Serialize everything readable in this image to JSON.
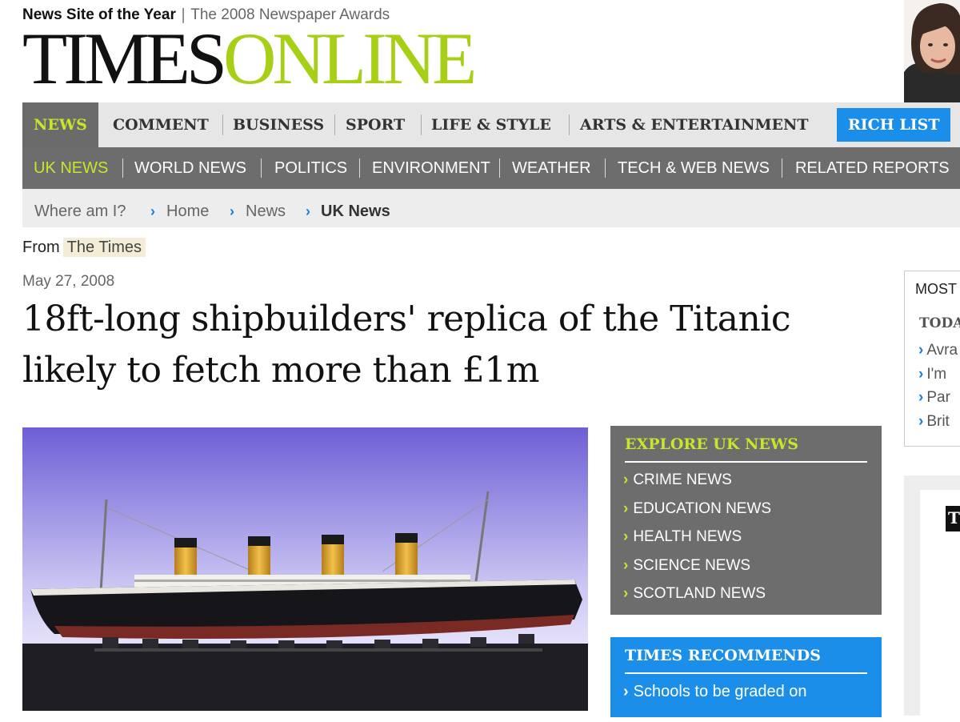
{
  "masthead": {
    "award_bold": "News Site of the Year",
    "award_rest": "The 2008 Newspaper Awards",
    "logo_times": "TIMES",
    "logo_online": "ONLINE"
  },
  "nav_primary": {
    "items": [
      "NEWS",
      "COMMENT",
      "BUSINESS",
      "SPORT",
      "LIFE & STYLE",
      "ARTS & ENTERTAINMENT"
    ],
    "active": "NEWS",
    "rich_list": "RICH LIST"
  },
  "nav_secondary": {
    "items": [
      "UK NEWS",
      "WORLD NEWS",
      "POLITICS",
      "ENVIRONMENT",
      "WEATHER",
      "TECH & WEB NEWS",
      "RELATED REPORTS"
    ],
    "active": "UK NEWS"
  },
  "breadcrumb": {
    "prefix": "Where am I?",
    "items": [
      "Home",
      "News",
      "UK News"
    ]
  },
  "article": {
    "from_label": "From",
    "publication": "The Times",
    "date": "May 27, 2008",
    "headline": "18ft-long shipbuilders' replica of the Titanic likely to fetch more than £1m"
  },
  "explore": {
    "title": "EXPLORE UK NEWS",
    "items": [
      "CRIME NEWS",
      "EDUCATION NEWS",
      "HEALTH NEWS",
      "SCIENCE NEWS",
      "SCOTLAND NEWS"
    ]
  },
  "recommends": {
    "title": "TIMES RECOMMENDS",
    "items": [
      "Schools to be graded on"
    ]
  },
  "most_panel": {
    "title": "MOST",
    "tab": "TODA",
    "items": [
      "Avra",
      "I'm",
      "Par",
      "Brit"
    ]
  },
  "side_box": {
    "letter": "T"
  },
  "colors": {
    "accent_green": "#c7e52a",
    "logo_green": "#a6cf16",
    "nav_gray": "#6d6d6d",
    "link_blue": "#1a8ee8"
  }
}
